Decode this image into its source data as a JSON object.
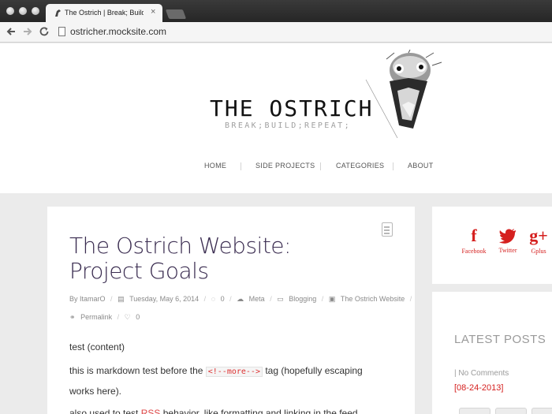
{
  "browser": {
    "tab_title": "The Ostrich | Break; Build; Repeat;",
    "tab_close": "×",
    "url": "ostricher.mocksite.com",
    "icons": {
      "back": "back-arrow-icon",
      "forward": "forward-arrow-icon",
      "reload": "reload-icon",
      "page": "page-icon"
    }
  },
  "site": {
    "title": "THE OSTRICH",
    "tagline": "BREAK;BUILD;REPEAT;",
    "nav": [
      "HOME",
      "SIDE PROJECTS",
      "CATEGORIES",
      "ABOUT"
    ]
  },
  "post": {
    "title": "The Ostrich Website: Project Goals",
    "meta": {
      "author": "By ItamarO",
      "date": "Tuesday, May 6, 2014",
      "comments": "0",
      "category1": "Meta",
      "category2": "Blogging",
      "category3": "The Ostrich Website",
      "permalink": "Permalink",
      "likes": "0"
    },
    "p1": "test (content)",
    "p2_before": "this is markdown test before the ",
    "p2_code": "<!--more-->",
    "p2_after": " tag (hopefully escaping works here).",
    "p3_before": "also used to test ",
    "p3_link": "RSS",
    "p3_after": " behavior, like formatting and linking in the feed..."
  },
  "sidebar": {
    "social": [
      {
        "glyph": "f",
        "label": "Facebook",
        "icon": "facebook-icon"
      },
      {
        "glyph": "🐦",
        "label": "Twitter",
        "icon": "twitter-icon"
      },
      {
        "glyph": "g+",
        "label": "Gplus",
        "icon": "gplus-icon"
      }
    ],
    "latest_title": "LATEST POSTS",
    "latest_meta": "| No Comments",
    "latest_date": "[08-24-2013]"
  },
  "colors": {
    "accent": "#d5201f",
    "title": "#3a2c50",
    "background": "#ebebeb"
  }
}
